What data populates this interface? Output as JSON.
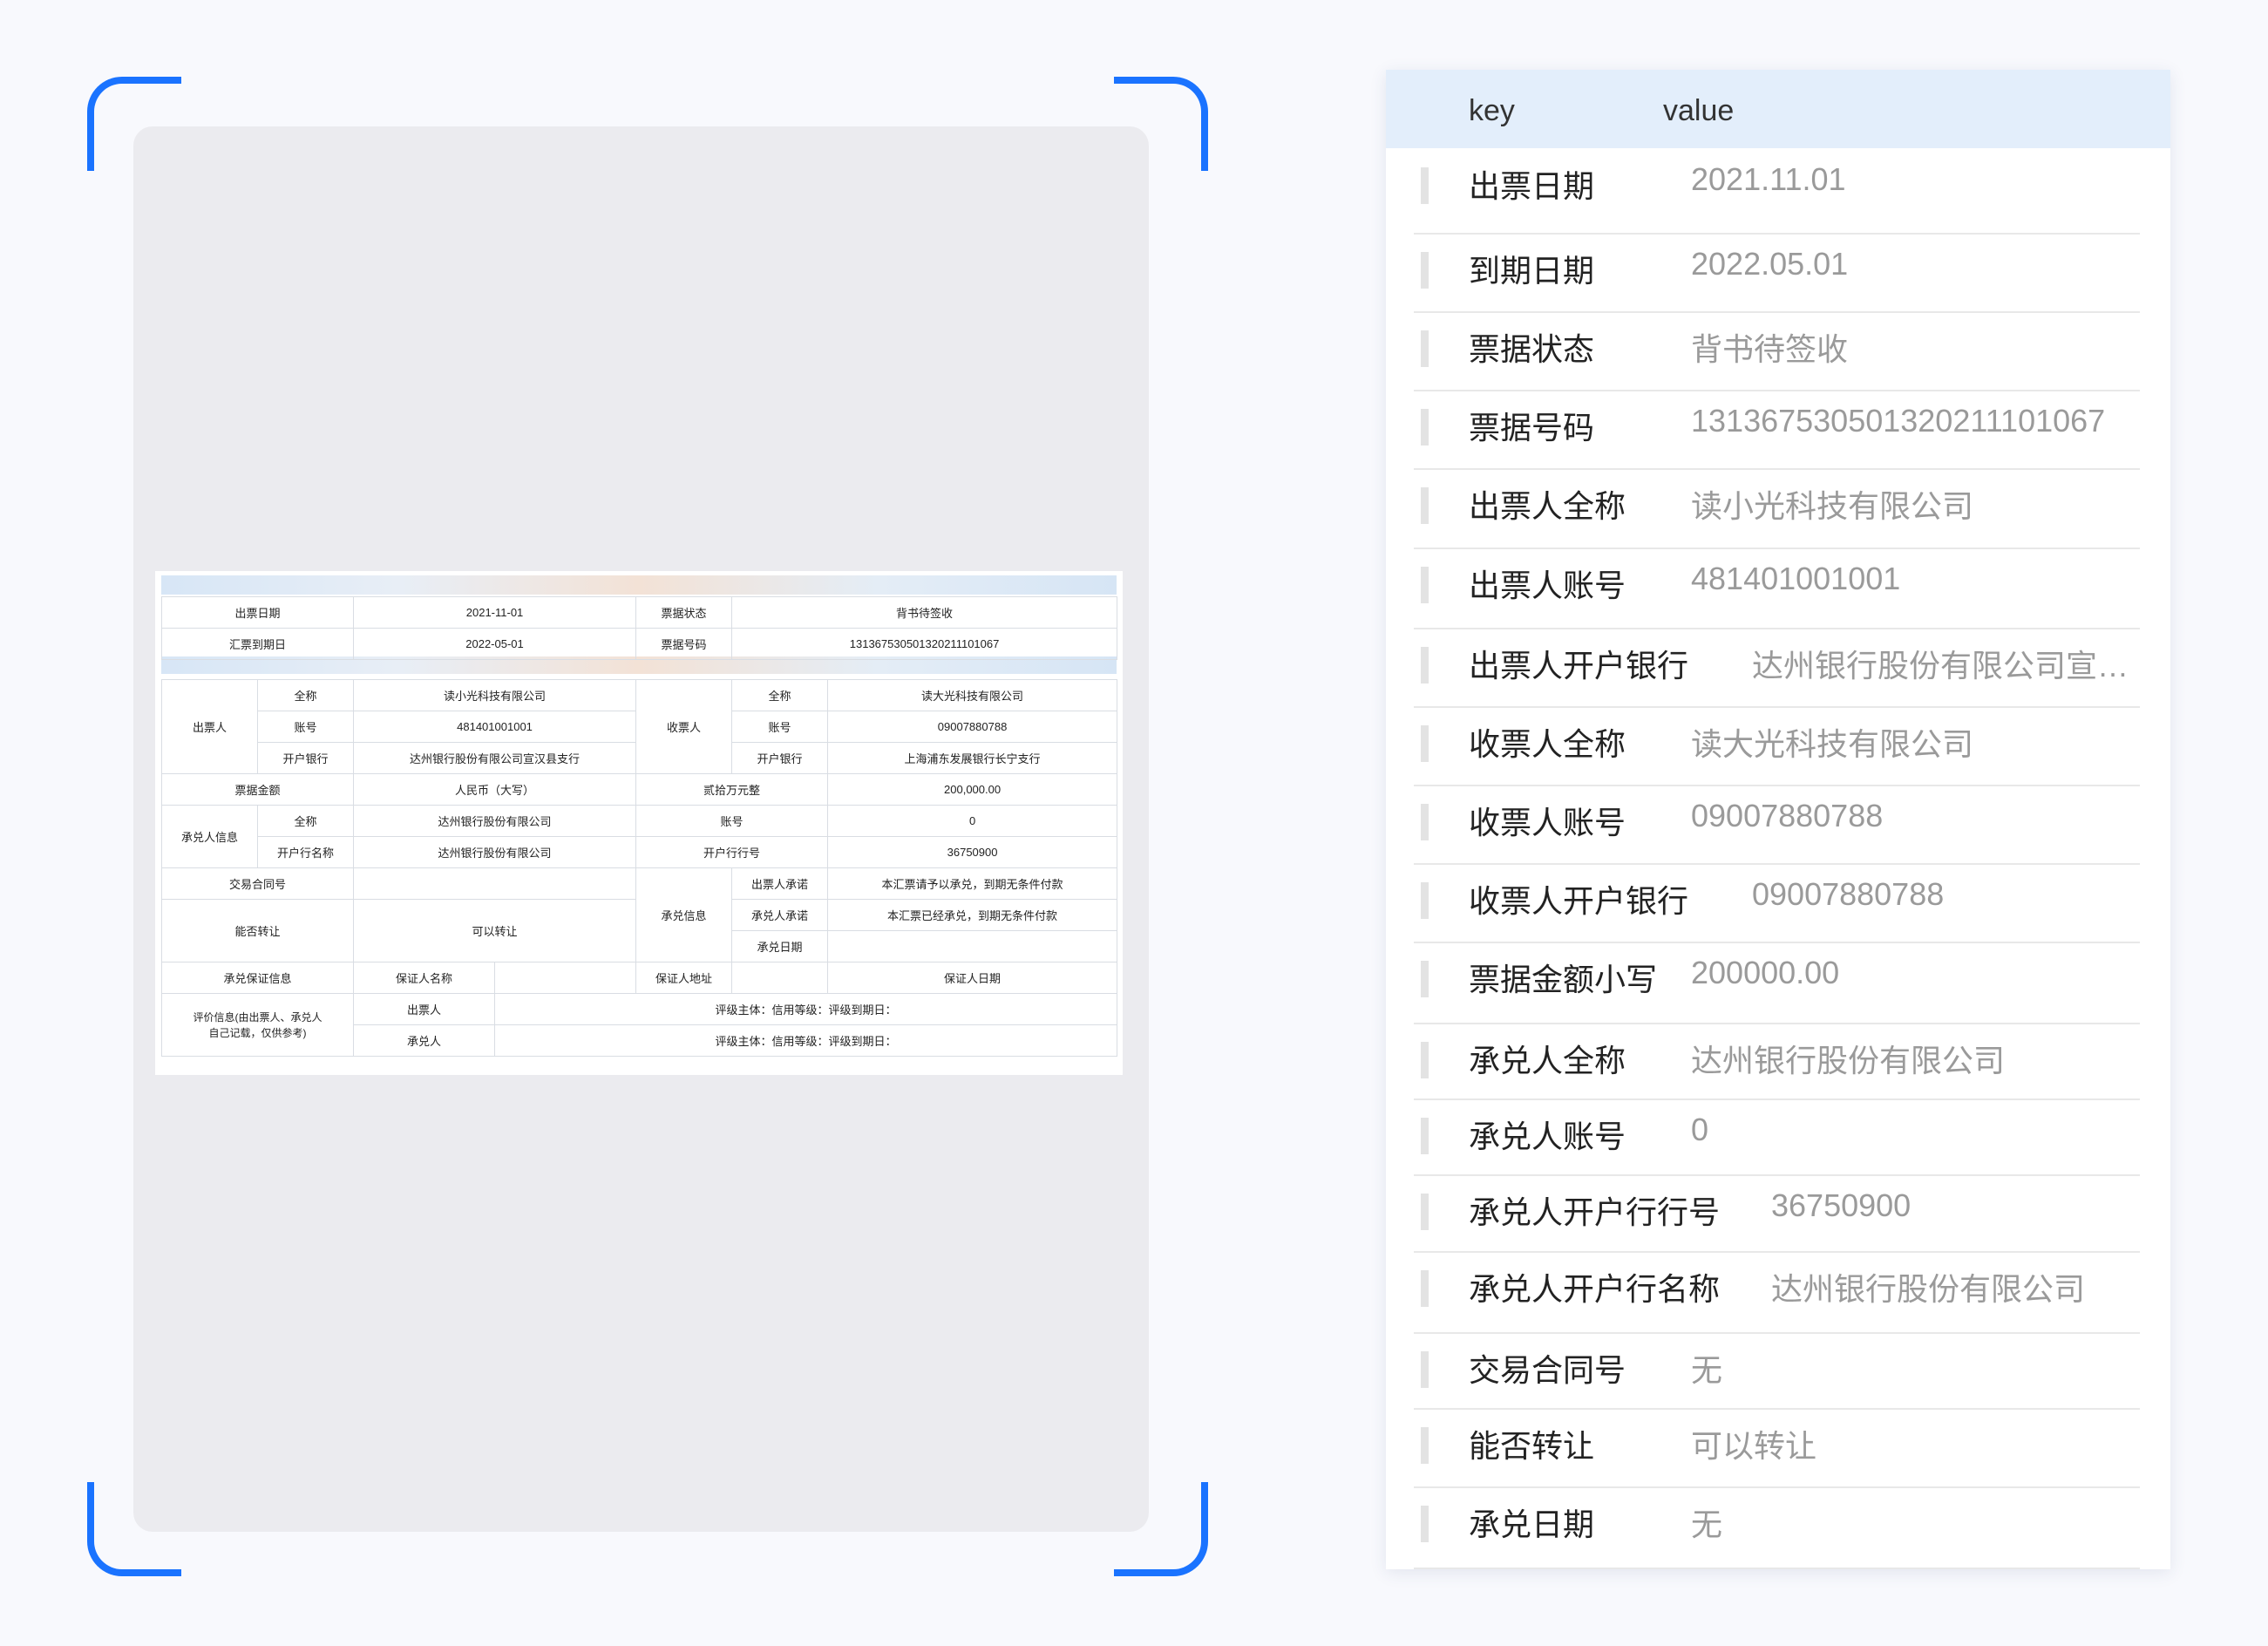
{
  "bill": {
    "rows": [
      [
        "出票日期",
        "2021-11-01",
        "票据状态",
        "背书待签收"
      ],
      [
        "汇票到期日",
        "2022-05-01",
        "票据号码",
        "131367530501320211101067"
      ]
    ],
    "drawer_label": "出票人",
    "payee_label": "收票人",
    "full_name": "全称",
    "account": "账号",
    "bank": "开户银行",
    "drawer_name": "读小光科技有限公司",
    "drawer_account": "481401001001",
    "drawer_bank": "达州银行股份有限公司宣汉县支行",
    "payee_name": "读大光科技有限公司",
    "payee_account": "09007880788",
    "payee_bank": "上海浦东发展银行长宁支行",
    "amount_label": "票据金额",
    "amount_rmb": "人民币（大写）",
    "amount_cn": "贰拾万元整",
    "amount_num": "200,000.00",
    "acceptor_label": "承兑人信息",
    "acc_full": "全称",
    "acc_name": "达州银行股份有限公司",
    "acc_account_label": "账号",
    "acc_account": "0",
    "acc_bankname_label": "开户行名称",
    "acc_bankname": "达州银行股份有限公司",
    "acc_bankno_label": "开户行行号",
    "acc_bankno": "36750900",
    "contract_label": "交易合同号",
    "accept_info_label": "承兑信息",
    "drawer_promise_label": "出票人承诺",
    "drawer_promise": "本汇票请予以承兑，到期无条件付款",
    "acceptor_promise_label": "承兑人承诺",
    "acceptor_promise": "本汇票已经承兑，到期无条件付款",
    "transfer_label": "能否转让",
    "transfer_value": "可以转让",
    "accept_date_label": "承兑日期",
    "guarantee_label": "承兑保证信息",
    "guarantor_name": "保证人名称",
    "guarantor_addr": "保证人地址",
    "guarantor_date": "保证人日期",
    "rating_label_1": "评价信息(由出票人、承兑人",
    "rating_label_2": "自己记载，仅供参考)",
    "rating_drawer": "出票人",
    "rating_acceptor": "承兑人",
    "rating_text": "评级主体：信用等级：评级到期日："
  },
  "panel": {
    "header_key": "key",
    "header_value": "value",
    "rows": [
      {
        "key": "出票日期",
        "value": "2021.11.01"
      },
      {
        "key": "到期日期",
        "value": "2022.05.01"
      },
      {
        "key": "票据状态",
        "value": "背书待签收"
      },
      {
        "key": "票据号码",
        "value": "131367530501320211101067"
      },
      {
        "key": "出票人全称",
        "value": "读小光科技有限公司"
      },
      {
        "key": "出票人账号",
        "value": "481401001001"
      },
      {
        "key": "出票人开户银行",
        "value": "达州银行股份有限公司宣汉..."
      },
      {
        "key": "收票人全称",
        "value": "读大光科技有限公司"
      },
      {
        "key": "收票人账号",
        "value": "09007880788"
      },
      {
        "key": "收票人开户银行",
        "value": "09007880788"
      },
      {
        "key": "票据金额小写",
        "value": "200000.00"
      },
      {
        "key": "承兑人全称",
        "value": "达州银行股份有限公司"
      },
      {
        "key": "承兑人账号",
        "value": "0"
      },
      {
        "key": "承兑人开户行行号",
        "value": "36750900"
      },
      {
        "key": "承兑人开户行名称",
        "value": "达州银行股份有限公司"
      },
      {
        "key": "交易合同号",
        "value": "无"
      },
      {
        "key": "能否转让",
        "value": "可以转让"
      },
      {
        "key": "承兑日期",
        "value": "无"
      }
    ]
  }
}
